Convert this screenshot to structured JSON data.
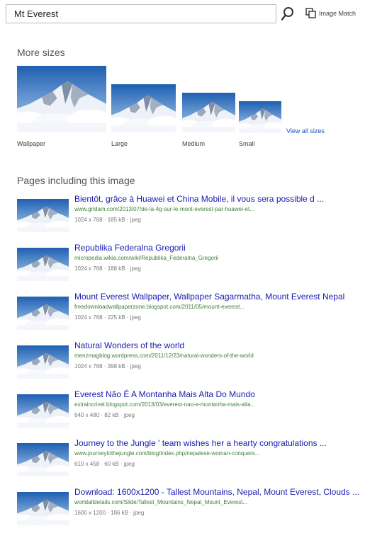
{
  "search": {
    "query": "Mt Everest"
  },
  "toolbar": {
    "search_icon": "search-icon",
    "image_match_icon": "image-match-icon",
    "image_match_label": "Image Match"
  },
  "more_sizes": {
    "title": "More sizes",
    "sizes": [
      {
        "label": "Wallpaper"
      },
      {
        "label": "Large"
      },
      {
        "label": "Medium"
      },
      {
        "label": "Small"
      }
    ],
    "view_all": "View all sizes"
  },
  "pages": {
    "title": "Pages including this image",
    "results": [
      {
        "title": "Bientôt, grâce à Huawei et China Mobile, il vous sera possible d ...",
        "url": "www.gridam.com/2013/07/de-la-4g-sur-le-mont-everest-par-huawei-et...",
        "meta": "1024 x 768 · 185 kB · jpeg"
      },
      {
        "title": "Republika Federalna Gregorii",
        "url": "micropedia.wikia.com/wiki/Republika_Federalna_Gregorii",
        "meta": "1024 x 768 · 188 kB · jpeg"
      },
      {
        "title": "Mount Everest Wallpaper, Wallpaper Sagarmatha, Mount Everest Nepal",
        "url": "freedownloadwallpaperzone.blogspot.com/2011/05/mount-everest...",
        "meta": "1024 x 768 · 225 kB · jpeg"
      },
      {
        "title": "Natural Wonders of the world",
        "url": "menzmagblog.wordpress.com/2011/12/23/natural-wonders-of-the-world",
        "meta": "1024 x 768 · 398 kB · jpeg"
      },
      {
        "title": "Everest Não É A Montanha Mais Alta Do Mundo",
        "url": "extraincrivel.blogspot.com/2013/03/everest-nao-e-montanha-mais-alta...",
        "meta": "640 x 480 · 82 kB · jpeg"
      },
      {
        "title": "Journey to the Jungle ' team wishes her a hearty congratulations ...",
        "url": "www.journeytothejungle.com/blog/index.php/nepalese-woman-conquers...",
        "meta": "610 x 458 · 60 kB · jpeg"
      },
      {
        "title": "Download: 1600x1200 - Tallest Mountains, Nepal, Mount Everest, Clouds ...",
        "url": "worldalldetails.com/Slide/Tallest_Mountains_Nepal_Mount_Everest...",
        "meta": "1600 x 1200 · 186 kB · jpeg"
      }
    ]
  }
}
